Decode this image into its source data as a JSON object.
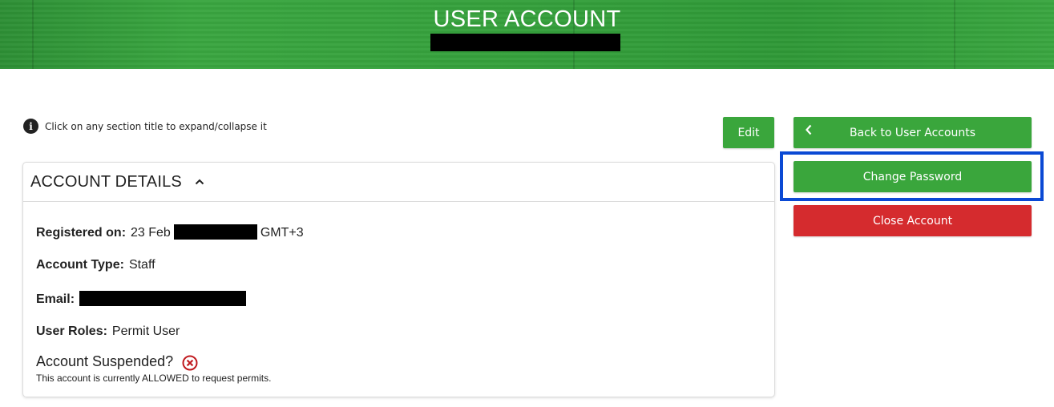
{
  "header": {
    "title": "USER ACCOUNT"
  },
  "info": {
    "icon": "info-icon",
    "text": "Click on any section title to expand/collapse it"
  },
  "buttons": {
    "edit": "Edit",
    "back": "Back to User Accounts",
    "change_password": "Change Password",
    "close_account": "Close Account"
  },
  "account_details": {
    "title": "ACCOUNT DETAILS",
    "registered_label": "Registered on:",
    "registered_prefix": "23 Feb",
    "registered_suffix": "GMT+3",
    "account_type_label": "Account Type:",
    "account_type_value": "Staff",
    "email_label": "Email:",
    "user_roles_label": "User Roles:",
    "user_roles_value": "Permit User",
    "suspended_label": "Account Suspended?",
    "suspended_note": "This account is currently ALLOWED to request permits."
  },
  "colors": {
    "brand_green": "#3aa63c",
    "danger_red": "#d52b2e",
    "highlight_blue": "#0a49d4"
  }
}
